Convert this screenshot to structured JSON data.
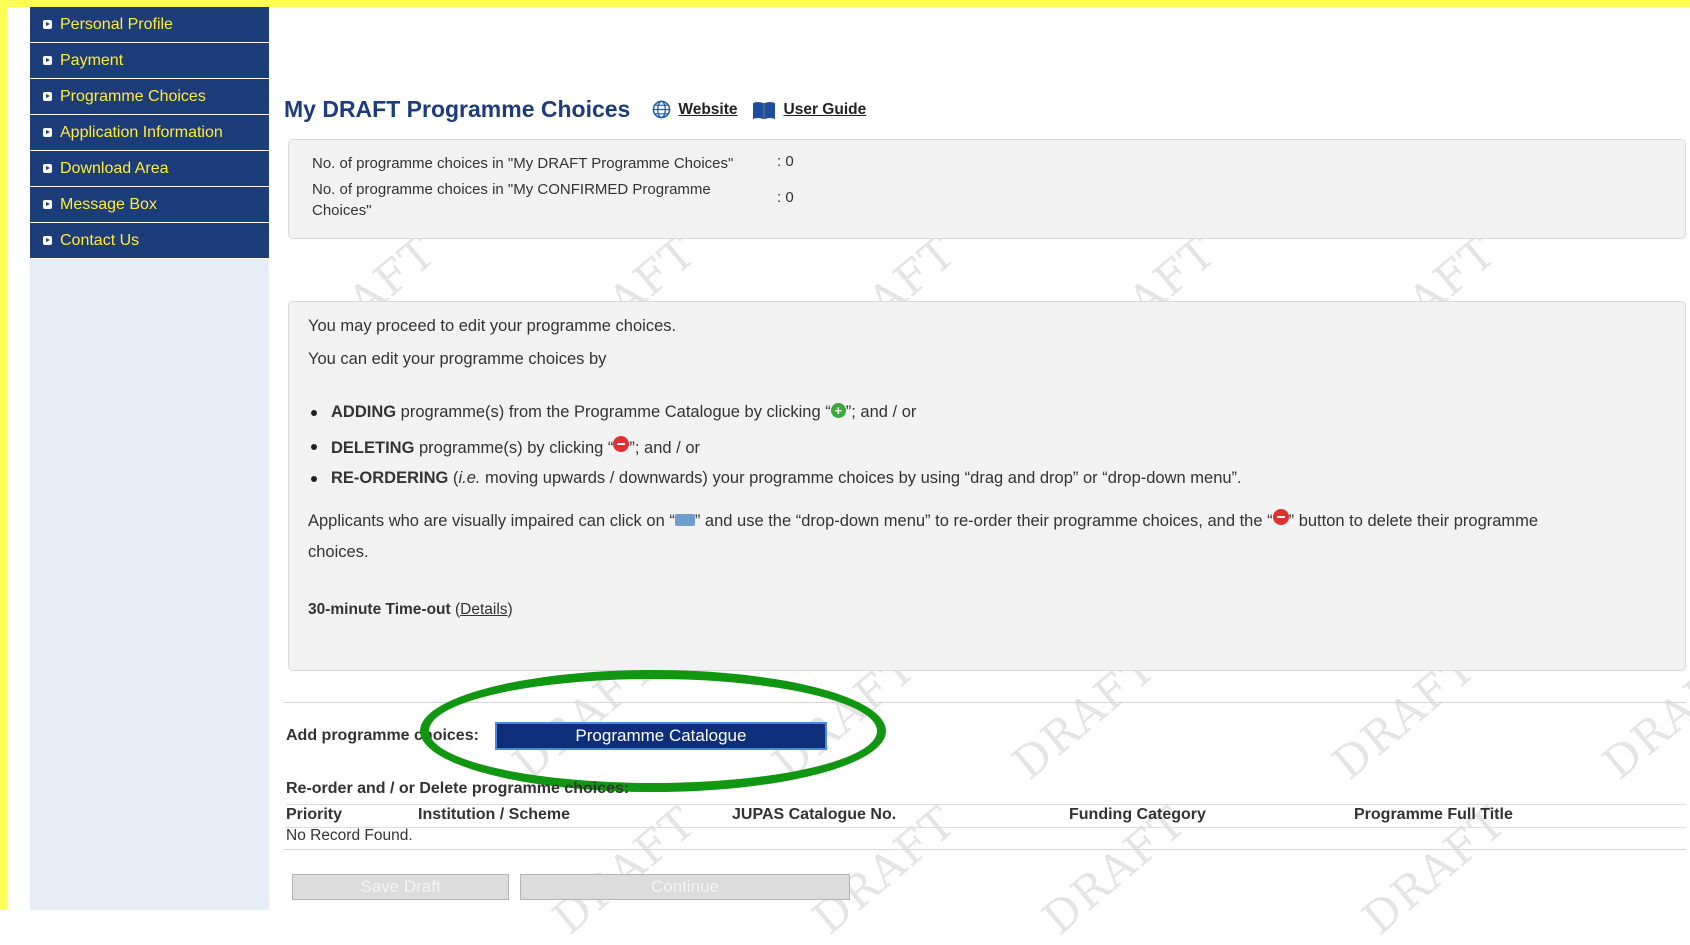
{
  "sidebar": {
    "items": [
      {
        "label": "Personal Profile"
      },
      {
        "label": "Payment"
      },
      {
        "label": "Programme Choices"
      },
      {
        "label": "Application Information"
      },
      {
        "label": "Download Area"
      },
      {
        "label": "Message Box"
      },
      {
        "label": "Contact Us"
      }
    ]
  },
  "header": {
    "title": "My DRAFT Programme Choices",
    "website_label": "Website",
    "user_guide_label": "User Guide"
  },
  "counts": {
    "draft_label": "No. of programme choices in \"My DRAFT Programme Choices\"",
    "draft_value": ": 0",
    "confirmed_label": "No. of programme choices in \"My CONFIRMED Programme Choices\"",
    "confirmed_value": ": 0"
  },
  "info": {
    "line1": "You may proceed to edit your programme choices.",
    "line2": "You can edit your programme choices by",
    "adding_bold": "ADDING",
    "adding_text_a": " programme(s) from the Programme Catalogue by clicking “",
    "adding_text_b": "”; and / or",
    "deleting_bold": "DELETING",
    "deleting_text_a": " programme(s) by clicking “",
    "deleting_text_b": "”; and / or",
    "reorder_bold": "RE-ORDERING",
    "reorder_text_a": " (",
    "reorder_italic": "i.e.",
    "reorder_text_b": " moving upwards / downwards) your programme choices by using “drag and drop” or “drop-down menu”.",
    "visual_text_a": "Applicants who are visually impaired can click on “",
    "visual_text_b": "” and use the “drop-down menu” to re-order their programme choices, and the “",
    "visual_text_c": "” button to delete their programme",
    "visual_text_d": "choices.",
    "timeout_bold": "30-minute Time-out",
    "timeout_open": " (",
    "details_link": "Details",
    "timeout_close": ")"
  },
  "add_section": {
    "label": "Add programme choices:",
    "catalogue_button": "Programme Catalogue"
  },
  "reorder_section": {
    "label": "Re-order and / or Delete programme choices:"
  },
  "table": {
    "columns": [
      "Priority",
      "Institution / Scheme",
      "JUPAS Catalogue No.",
      "Funding Category",
      "Programme Full Title"
    ],
    "empty_text": "No Record Found."
  },
  "footer": {
    "save_draft": "Save Draft",
    "continue": "Continue"
  },
  "watermark_text": "DRAFT",
  "colors": {
    "nav_bg": "#1d3c7a",
    "nav_text": "#ffee33",
    "title": "#1d3c7a",
    "highlight": "#119611",
    "frame": "#ffff55"
  },
  "icons": {
    "website": "globe-icon",
    "user_guide": "book-icon",
    "add": "plus-circle-icon",
    "delete": "minus-circle-icon",
    "accessibility": "keyboard-icon"
  }
}
